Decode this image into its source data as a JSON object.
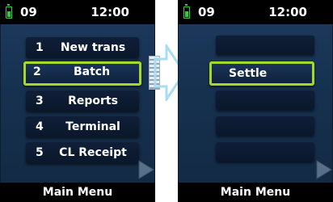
{
  "status": {
    "signal": "09",
    "time": "12:00"
  },
  "main_menu": {
    "items": [
      {
        "num": "1",
        "label": "New trans"
      },
      {
        "num": "2",
        "label": "Batch"
      },
      {
        "num": "3",
        "label": "Reports"
      },
      {
        "num": "4",
        "label": "Terminal"
      },
      {
        "num": "5",
        "label": "CL Receipt"
      }
    ],
    "selected_index": 1,
    "footer": "Main Menu"
  },
  "submenu": {
    "items": [
      {
        "label": ""
      },
      {
        "label": "Settle"
      },
      {
        "label": ""
      },
      {
        "label": ""
      },
      {
        "label": ""
      }
    ],
    "selected_index": 1,
    "footer": "Main Menu"
  },
  "icons": {
    "battery": "battery-icon",
    "next": "next-page-arrow-icon",
    "transition": "transition-arrow-icon"
  },
  "colors": {
    "selection_outline": "#a6d927",
    "battery": "#2ecc40",
    "screen_bg": "#1e3a5f",
    "bar_bg": "#000000"
  }
}
